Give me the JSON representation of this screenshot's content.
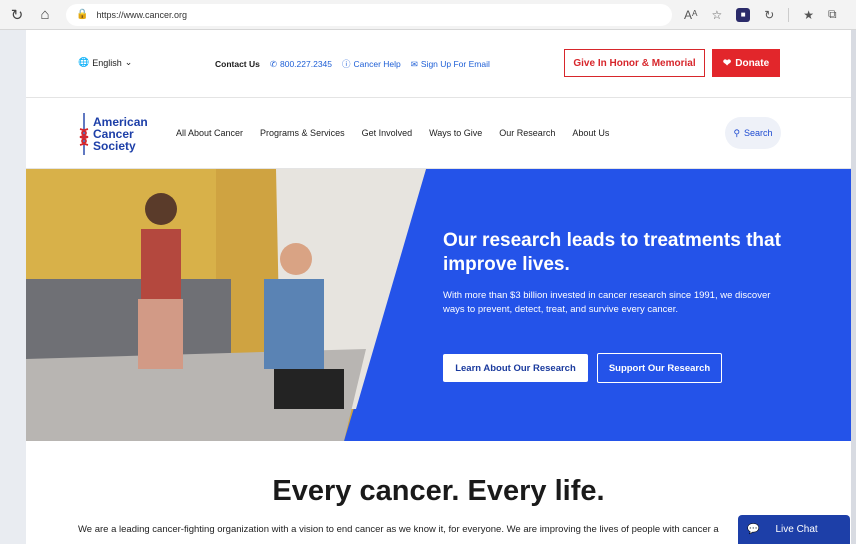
{
  "browser": {
    "url": "https://www.cancer.org",
    "reader_label": "Aᴬ"
  },
  "utility": {
    "language": "English",
    "contact_label": "Contact Us",
    "phone": "800.227.2345",
    "cancer_help": "Cancer Help",
    "signup_email": "Sign Up For Email",
    "honor_button": "Give In Honor & Memorial",
    "donate_button": "Donate"
  },
  "logo": {
    "line1": "American",
    "line2": "Cancer",
    "line3": "Society"
  },
  "nav": {
    "items": [
      "All About Cancer",
      "Programs & Services",
      "Get Involved",
      "Ways to Give",
      "Our Research",
      "About Us"
    ],
    "search_label": "Search"
  },
  "hero": {
    "title": "Our research leads to treatments that improve lives.",
    "subtitle": "With more than $3 billion invested in cancer research since 1991, we discover ways to prevent, detect, treat, and survive every cancer.",
    "primary_button": "Learn About Our Research",
    "secondary_button": "Support Our Research"
  },
  "content": {
    "headline": "Every cancer. Every life.",
    "body": "We are a leading cancer-fighting organization with a vision to end cancer as we know it, for everyone. We are improving the lives of people with cancer a"
  },
  "chat": {
    "label": "Live Chat"
  },
  "colors": {
    "brand_blue": "#1d3fa8",
    "hero_blue": "#2453e9",
    "donate_red": "#e2262b"
  }
}
